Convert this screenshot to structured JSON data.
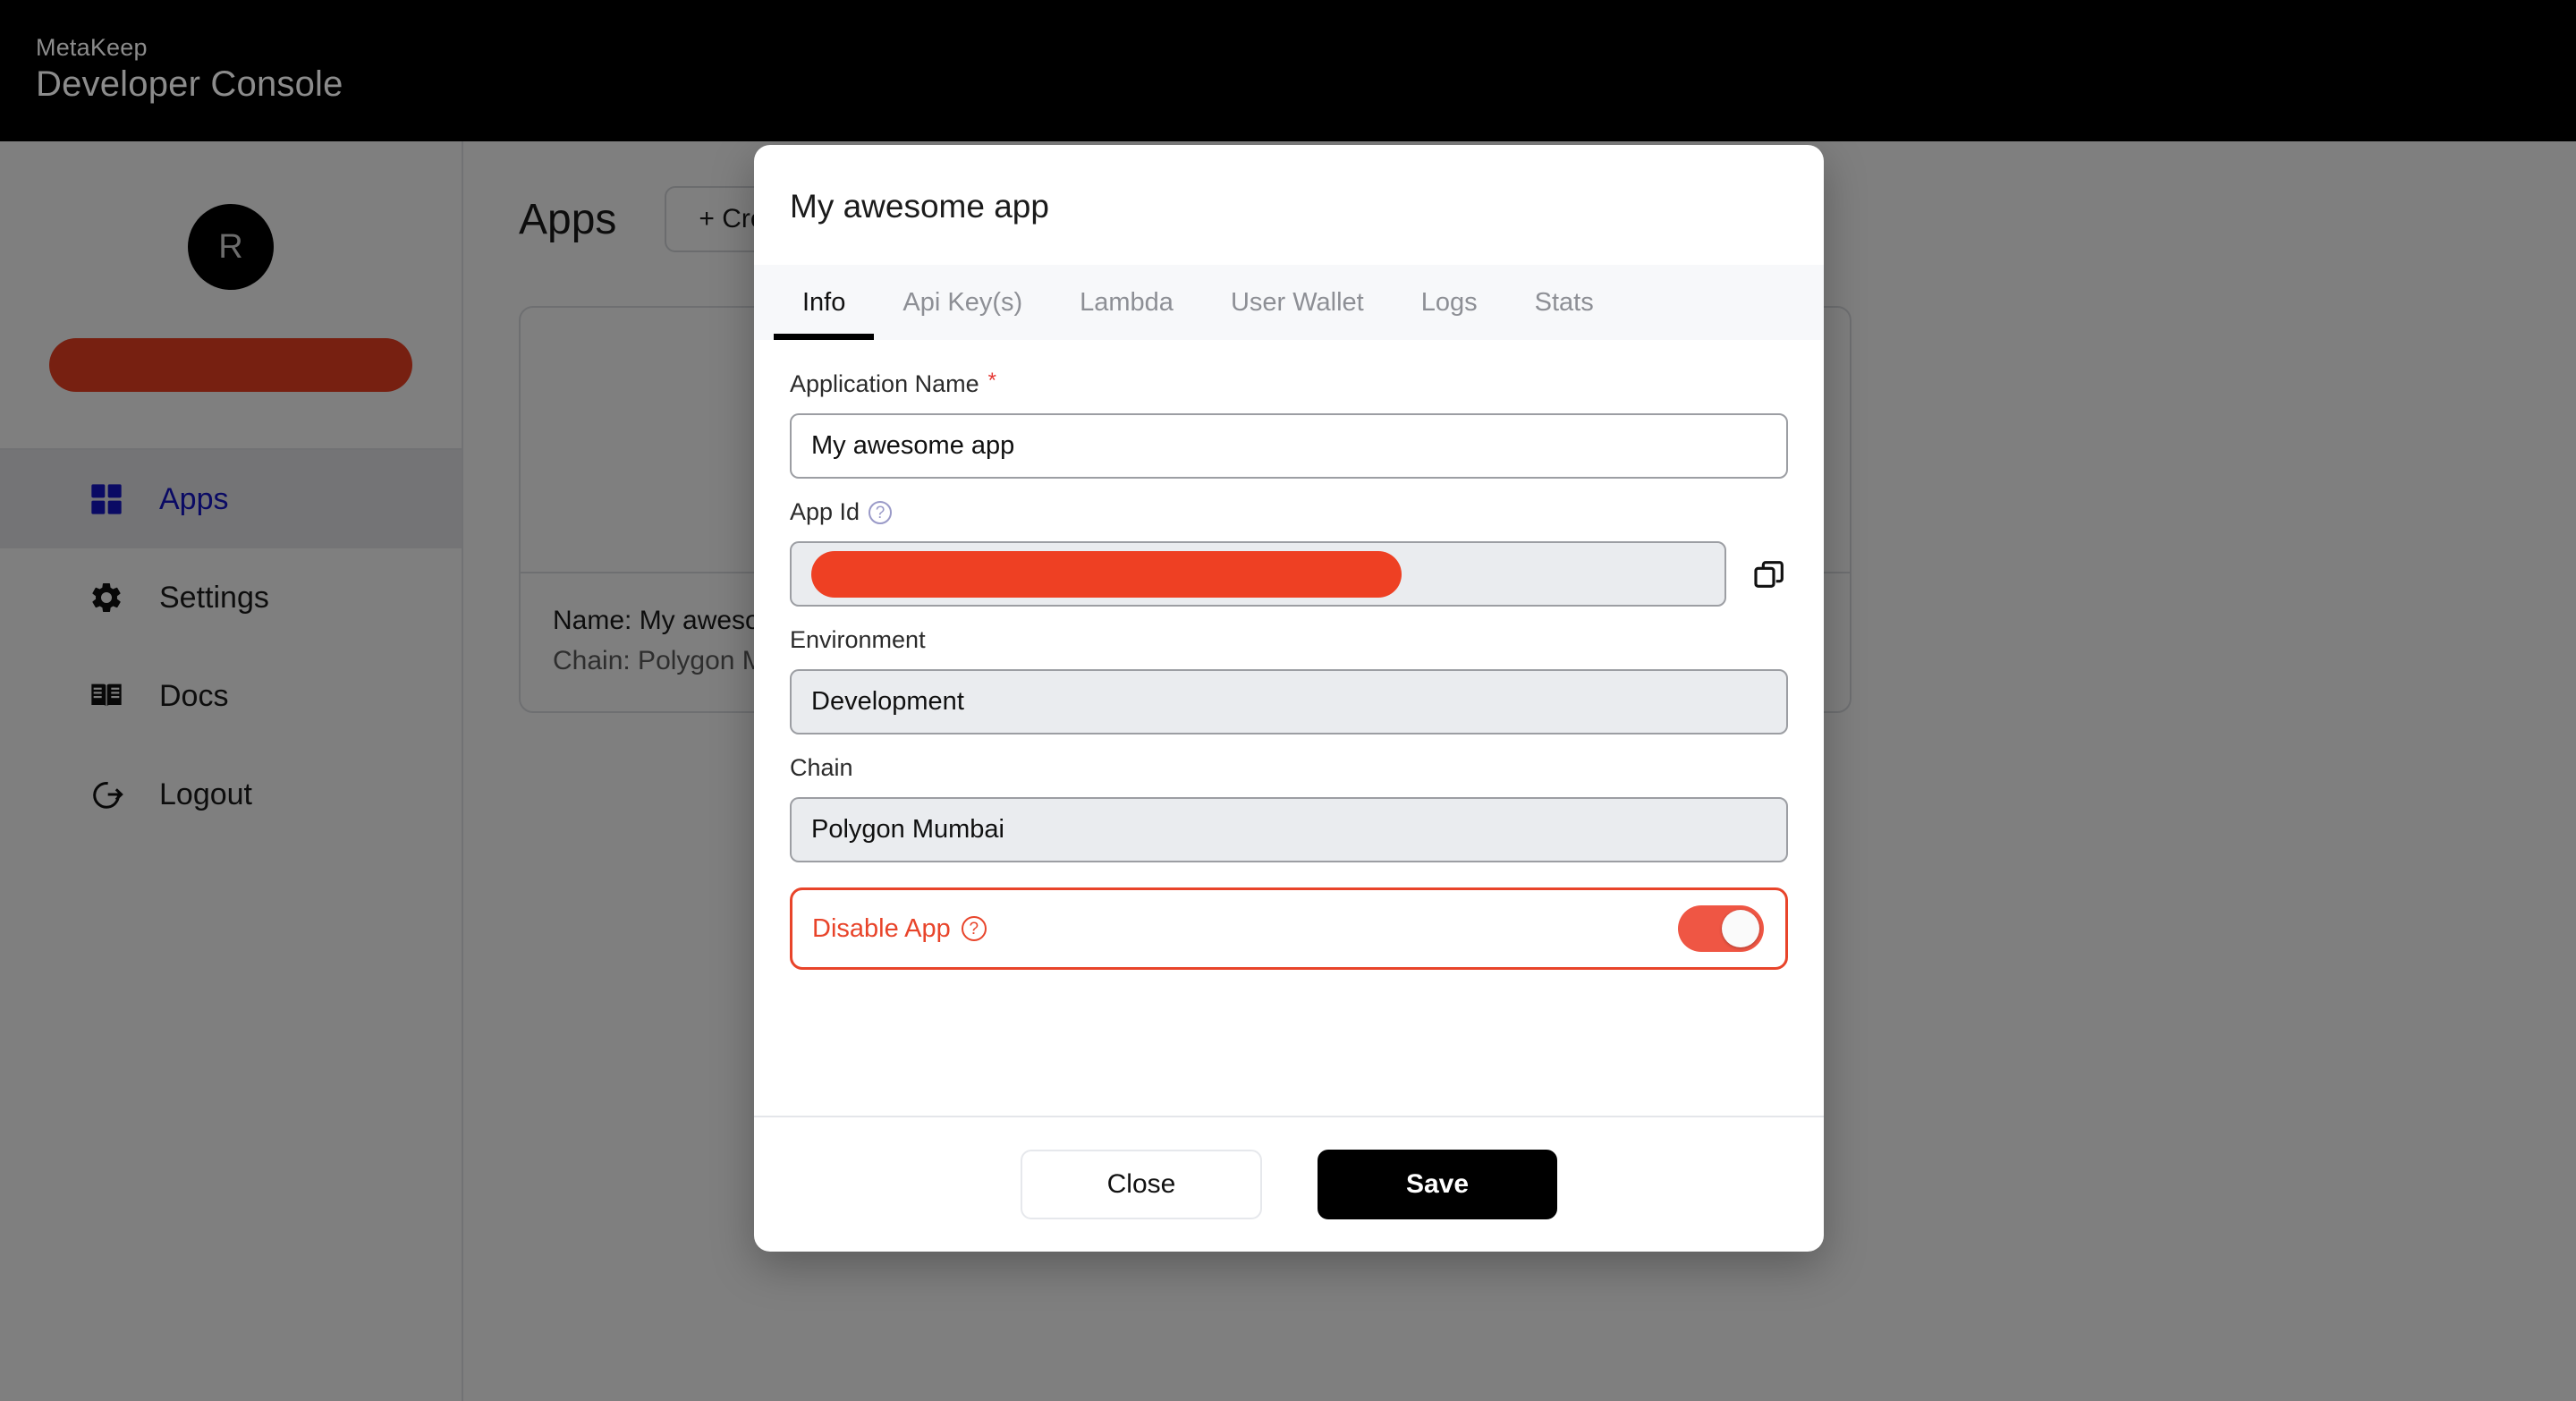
{
  "topbar": {
    "brand_small": "MetaKeep",
    "brand_large": "Developer Console"
  },
  "sidebar": {
    "avatar_initial": "R",
    "account_name_redacted": "",
    "items": [
      {
        "label": "Apps",
        "icon": "grid-icon",
        "active": true
      },
      {
        "label": "Settings",
        "icon": "gear-icon",
        "active": false
      },
      {
        "label": "Docs",
        "icon": "book-icon",
        "active": false
      },
      {
        "label": "Logout",
        "icon": "logout-icon",
        "active": false
      }
    ]
  },
  "content": {
    "page_title": "Apps",
    "create_button": "+ Create App",
    "app_card": {
      "name_line": "Name: My awesome app",
      "chain_line": "Chain: Polygon Mumbai"
    }
  },
  "modal": {
    "title": "My awesome app",
    "tabs": [
      {
        "label": "Info",
        "active": true
      },
      {
        "label": "Api Key(s)",
        "active": false
      },
      {
        "label": "Lambda",
        "active": false
      },
      {
        "label": "User Wallet",
        "active": false
      },
      {
        "label": "Logs",
        "active": false
      },
      {
        "label": "Stats",
        "active": false
      }
    ],
    "fields": {
      "application_name": {
        "label": "Application Name",
        "required_marker": "*",
        "value": "My awesome app",
        "placeholder": "Application Name"
      },
      "app_id": {
        "label": "App Id",
        "help": "?",
        "value": "",
        "copy_icon": "copy-icon"
      },
      "environment": {
        "label": "Environment",
        "value": "Development"
      },
      "chain": {
        "label": "Chain",
        "value": "Polygon Mumbai"
      }
    },
    "disable_app": {
      "label": "Disable App",
      "help": "?",
      "toggle_on": true
    },
    "footer": {
      "close_label": "Close",
      "save_label": "Save"
    }
  },
  "colors": {
    "accent_red": "#ee4023",
    "danger": "#e8442a",
    "active_nav": "#1414c8",
    "help_icon": "#9a9ac8",
    "black": "#000000"
  }
}
